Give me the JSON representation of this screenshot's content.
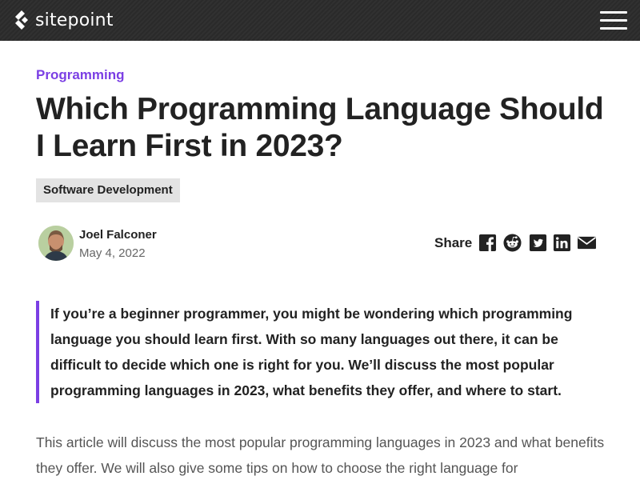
{
  "header": {
    "logo_text": "sitepoint",
    "menu_icon": "hamburger-menu-icon",
    "background": "#2a2a2a"
  },
  "article": {
    "category": "Programming",
    "title": "Which Programming Language Should I Learn First in 2023?",
    "tag": "Software Development",
    "author": {
      "name": "Joel Falconer",
      "date": "May 4, 2022"
    },
    "share": {
      "label": "Share",
      "icons": [
        "facebook-icon",
        "reddit-icon",
        "twitter-icon",
        "linkedin-icon",
        "email-icon"
      ]
    },
    "lead": "If you’re a beginner programmer, you might be wondering which programming language you should learn first. With so many languages out there, it can be difficult to decide which one is right for you. We’ll discuss the most popular programming languages in 2023, what benefits they offer, and where to start.",
    "body": "This article will discuss the most popular programming languages in 2023 and what benefits they offer. We will also give some tips on how to choose the right language for"
  },
  "colors": {
    "accent": "#7b3fe4",
    "tag_bg": "#e3e3e3"
  }
}
